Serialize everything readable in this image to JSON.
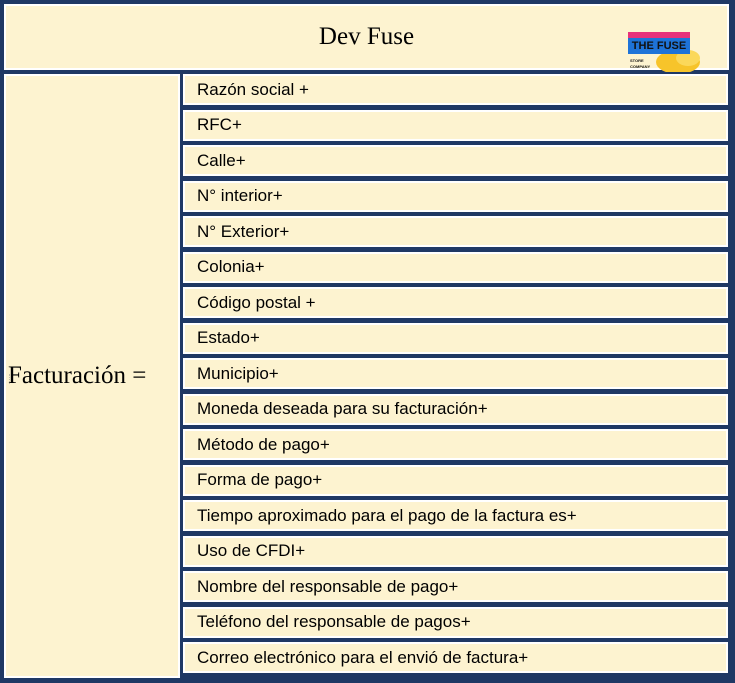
{
  "header": {
    "title": "Dev Fuse",
    "logo": {
      "line1": "THE FUSE",
      "line2": "STORE",
      "line3": "COMPANY"
    }
  },
  "left": {
    "label": "Facturación ="
  },
  "fields": [
    "Razón social +",
    "RFC+",
    "Calle+",
    "N° interior+",
    "N° Exterior+",
    "Colonia+",
    "Código postal +",
    "Estado+",
    "Municipio+",
    "Moneda deseada para su facturación+",
    "Método de pago+",
    "Forma de pago+",
    "Tiempo aproximado para el pago de la factura es+",
    "Uso de CFDI+",
    "Nombre del responsable de pago+",
    "Teléfono del responsable de pagos+",
    "Correo electrónico para el envió de factura+"
  ],
  "colors": {
    "border": "#1f3864",
    "cell_background": "#fdf3d0",
    "logo_blue": "#1e73d8",
    "logo_pink": "#e8317a",
    "logo_yellow": "#f7c42a"
  }
}
